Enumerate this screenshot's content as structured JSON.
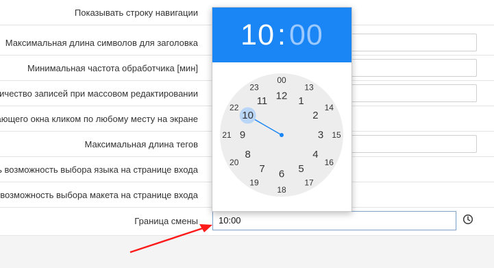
{
  "form": {
    "rows": [
      {
        "label": "Показывать строку навигации"
      },
      {
        "label": "Максимальная длина символов для заголовка"
      },
      {
        "label": "Минимальная частота обработчика [мин]"
      },
      {
        "label": "личество записей при массовом редактировании"
      },
      {
        "label": "вающего окна кликом по любому месту на экране"
      },
      {
        "label": "Максимальная длина тегов"
      },
      {
        "label": "ть возможность выбора языка на странице входа"
      },
      {
        "label": "ь возможность выбора макета на странице входа"
      },
      {
        "label": "Граница смены"
      }
    ],
    "shift_boundary_value": "10:00"
  },
  "clock_picker": {
    "hours": "10",
    "separator": ":",
    "minutes": "00",
    "outer_numbers": [
      "00",
      "13",
      "14",
      "15",
      "16",
      "17",
      "18",
      "19",
      "20",
      "21",
      "22",
      "23"
    ],
    "inner_numbers": [
      "12",
      "1",
      "2",
      "3",
      "4",
      "5",
      "6",
      "7",
      "8",
      "9",
      "10",
      "11"
    ],
    "selected": "10",
    "accent": "#1a86f6"
  },
  "icons": {
    "clock_button": "clock-icon"
  },
  "colors": {
    "annotation_arrow": "#ff1a1a"
  }
}
